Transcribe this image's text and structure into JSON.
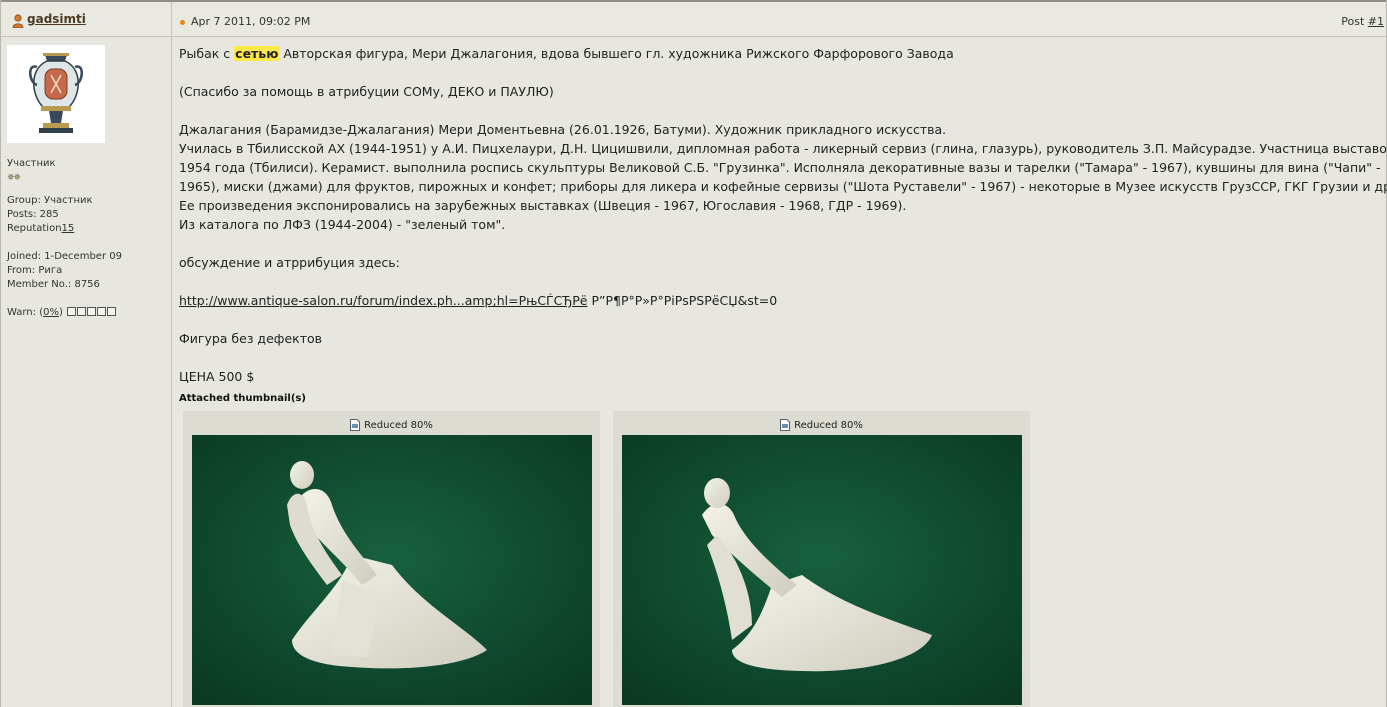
{
  "header": {
    "username": "gadsimti",
    "date": "Apr 7 2011, 09:02 PM",
    "post_label": "Post ",
    "post_number": "#1"
  },
  "user": {
    "rank": "Участник",
    "rank_stars": "✵✵",
    "group": "Group: Участник",
    "posts": "Posts: 285",
    "reputation_label": "Reputation",
    "reputation_value": "15",
    "joined": "Joined: 1-December 09",
    "from": "From: Рига",
    "member_no": "Member No.: 8756",
    "warn_label": "Warn: (",
    "warn_value": "0%",
    "warn_close": ")",
    "warn_level": 0
  },
  "post": {
    "line1_a": "Рыбак с ",
    "line1_hl": "сетью",
    "line1_b": " Авторская фигура, Мери Джалагония, вдова бывшего гл. художника Рижского Фарфорового Завода",
    "thanks": "(Спасибо за помощь в атрибуции СОМу, ДЕКО и ПАУЛЮ)",
    "bio": [
      "Джалагания (Барамидзе-Джалагания) Мери Доментьевна (26.01.1926, Батуми). Художник прикладного искусства.",
      "Училась в Тбилисской АХ (1944-1951) у А.И. Пицхелаури, Д.Н. Цицишвили, дипломная работа - ликерный сервиз (глина, глазурь), руководитель З.П. Майсурадзе. Участница выставок с",
      "1954 года (Тбилиси). Керамист. выполнила роспись скульптуры Великовой С.Б. \"Грузинка\". Исполняла декоративные вазы и тарелки (\"Тамара\" - 1967), кувшины для вина (\"Чапи\" -",
      "1965), миски (джами) для фруктов, пирожных и конфет; приборы для ликера и кофейные сервизы (\"Шота Руставели\" - 1967) - некоторые в Музее искусств ГрузССР, ГКГ Грузии и др.",
      "Ее произведения экспонировались на зарубежных выставках (Швеция - 1967, Югославия - 1968, ГДР - 1969).",
      "Из каталога по ЛФЗ (1944-2004) - \"зеленый том\"."
    ],
    "discussion": "обсуждение и атррибуция здесь:",
    "link_text": "http://www.antique-salon.ru/forum/index.ph...amp;hl=РњСЃСЂРё",
    "link_tail": " Р”Р¶Р°Р»Р°РіРѕРЅРёСЏ&st=0",
    "condition": "Фигура без дефектов",
    "price": "ЦЕНА 500 $",
    "attach_label": "Attached thumbnail(s)"
  },
  "thumbnails": [
    {
      "caption": "Reduced 80%"
    },
    {
      "caption": "Reduced 80%"
    }
  ],
  "colors": {
    "highlight": "#ffe94a",
    "photo_background": "#0f4a30",
    "figure": "#ecebe1"
  }
}
